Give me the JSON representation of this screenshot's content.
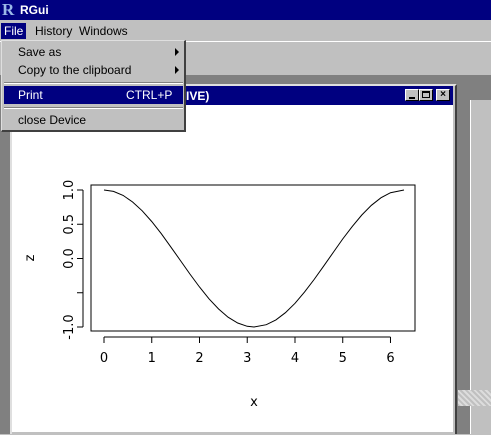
{
  "app": {
    "title": "RGui"
  },
  "menubar": {
    "items": [
      "File",
      "History",
      "Windows"
    ]
  },
  "file_menu": {
    "items": [
      {
        "label": "Save as",
        "submenu": true
      },
      {
        "label": "Copy to the clipboard",
        "submenu": true
      },
      {
        "label": "Print",
        "shortcut": "CTRL+P",
        "highlighted": true
      },
      {
        "label": "close Device"
      }
    ]
  },
  "graphics_window": {
    "title_visible": "IVE)",
    "buttons": [
      "minimize",
      "maximize",
      "close"
    ]
  },
  "colors": {
    "titlebar": "#000080",
    "face": "#c0c0c0",
    "workspace": "#808080"
  },
  "chart_data": {
    "type": "line",
    "xlabel": "x",
    "ylabel": "z",
    "xlim": [
      0,
      6.2832
    ],
    "ylim": [
      -1,
      1
    ],
    "x_ticks": [
      "0",
      "1",
      "2",
      "3",
      "4",
      "5",
      "6"
    ],
    "y_ticks": [
      "-1.0",
      "0.0",
      "0.5",
      "1.0"
    ],
    "series": [
      {
        "x": [
          0,
          0.2,
          0.4,
          0.6,
          0.8,
          1.0,
          1.2,
          1.4,
          1.6,
          1.8,
          2.0,
          2.2,
          2.4,
          2.6,
          2.8,
          3.0,
          3.1416,
          3.4,
          3.6,
          3.8,
          4.0,
          4.2,
          4.4,
          4.6,
          4.8,
          5.0,
          5.2,
          5.4,
          5.6,
          5.8,
          6.0,
          6.2832
        ],
        "y": [
          1.0,
          0.98,
          0.921,
          0.825,
          0.697,
          0.54,
          0.362,
          0.17,
          -0.029,
          -0.227,
          -0.416,
          -0.589,
          -0.737,
          -0.857,
          -0.942,
          -0.99,
          -1.0,
          -0.967,
          -0.897,
          -0.791,
          -0.654,
          -0.49,
          -0.307,
          -0.112,
          0.087,
          0.284,
          0.469,
          0.635,
          0.776,
          0.886,
          0.96,
          1.0
        ]
      }
    ]
  }
}
